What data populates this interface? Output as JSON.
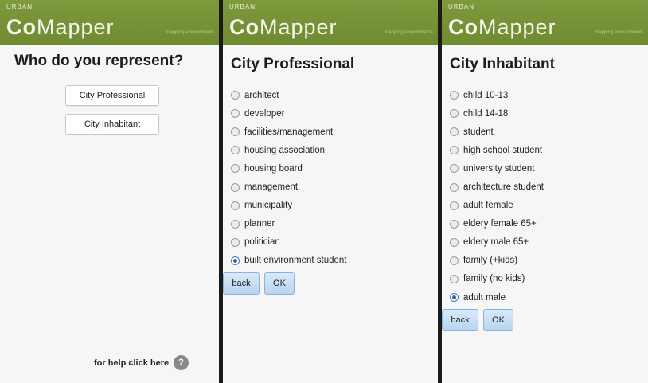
{
  "brand": {
    "top": "URBAN",
    "co": "Co",
    "mapper": "Mapper",
    "tagline": "mapping environments"
  },
  "screen1": {
    "title": "Who do you represent?",
    "buttons": [
      "City Professional",
      "City Inhabitant"
    ],
    "help_text": "for help click here",
    "help_icon": "?"
  },
  "screen2": {
    "title": "City Professional",
    "options": [
      "architect",
      "developer",
      "facilities/management",
      "housing association",
      "housing board",
      "management",
      "municipality",
      "planner",
      "politician",
      "built environment student"
    ],
    "selected": "built environment student",
    "back_label": "back",
    "ok_label": "OK"
  },
  "screen3": {
    "title": "City Inhabitant",
    "options": [
      "child 10-13",
      "child 14-18",
      "student",
      "high school student",
      "university student",
      "architecture student",
      "adult female",
      "eldery female 65+",
      "eldery male 65+",
      "family (+kids)",
      "family (no kids)",
      "adult male"
    ],
    "selected": "adult male",
    "back_label": "back",
    "ok_label": "OK"
  }
}
